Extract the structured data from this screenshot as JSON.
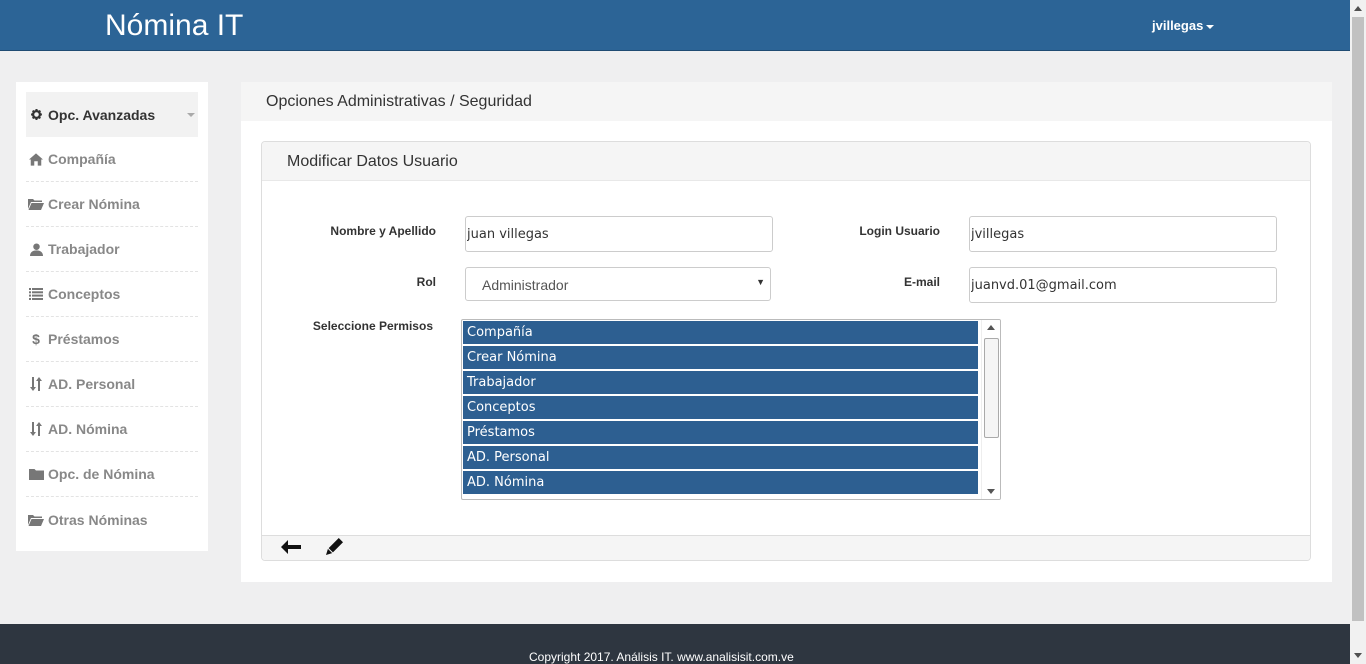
{
  "app": {
    "title": "Nómina IT"
  },
  "user_menu": {
    "username": "jvillegas"
  },
  "sidebar": {
    "items": [
      {
        "label": "Opc. Avanzadas",
        "icon": "gear-icon"
      },
      {
        "label": "Compañía",
        "icon": "home-icon"
      },
      {
        "label": "Crear Nómina",
        "icon": "folder-open-icon"
      },
      {
        "label": "Trabajador",
        "icon": "user-icon"
      },
      {
        "label": "Conceptos",
        "icon": "list-icon"
      },
      {
        "label": "Préstamos",
        "icon": "dollar-icon"
      },
      {
        "label": "AD. Personal",
        "icon": "sort-icon"
      },
      {
        "label": "AD. Nómina",
        "icon": "sort-icon"
      },
      {
        "label": "Opc. de Nómina",
        "icon": "folder-icon"
      },
      {
        "label": "Otras Nóminas",
        "icon": "folder-open-icon"
      }
    ]
  },
  "main": {
    "breadcrumb": "Opciones Administrativas / Seguridad",
    "panel_title": "Modificar Datos Usuario",
    "form": {
      "name_label": "Nombre y Apellido",
      "name_value": "juan villegas",
      "login_label": "Login Usuario",
      "login_value": "jvillegas",
      "role_label": "Rol",
      "role_value": "Administrador",
      "email_label": "E-mail",
      "email_value": "juanvd.01@gmail.com",
      "permissions_label": "Seleccione Permisos",
      "permissions": [
        "Compañía",
        "Crear Nómina",
        "Trabajador",
        "Conceptos",
        "Préstamos",
        "AD. Personal",
        "AD. Nómina"
      ]
    },
    "actions": {
      "back_icon": "arrow-left-icon",
      "edit_icon": "pencil-icon"
    }
  },
  "footer": {
    "copyright": "Copyright 2017. Análisis IT. www.analisisit.com.ve"
  },
  "colors": {
    "navbar": "#2c6496",
    "selected_option": "#2d5f91",
    "footer": "#2e3640"
  }
}
